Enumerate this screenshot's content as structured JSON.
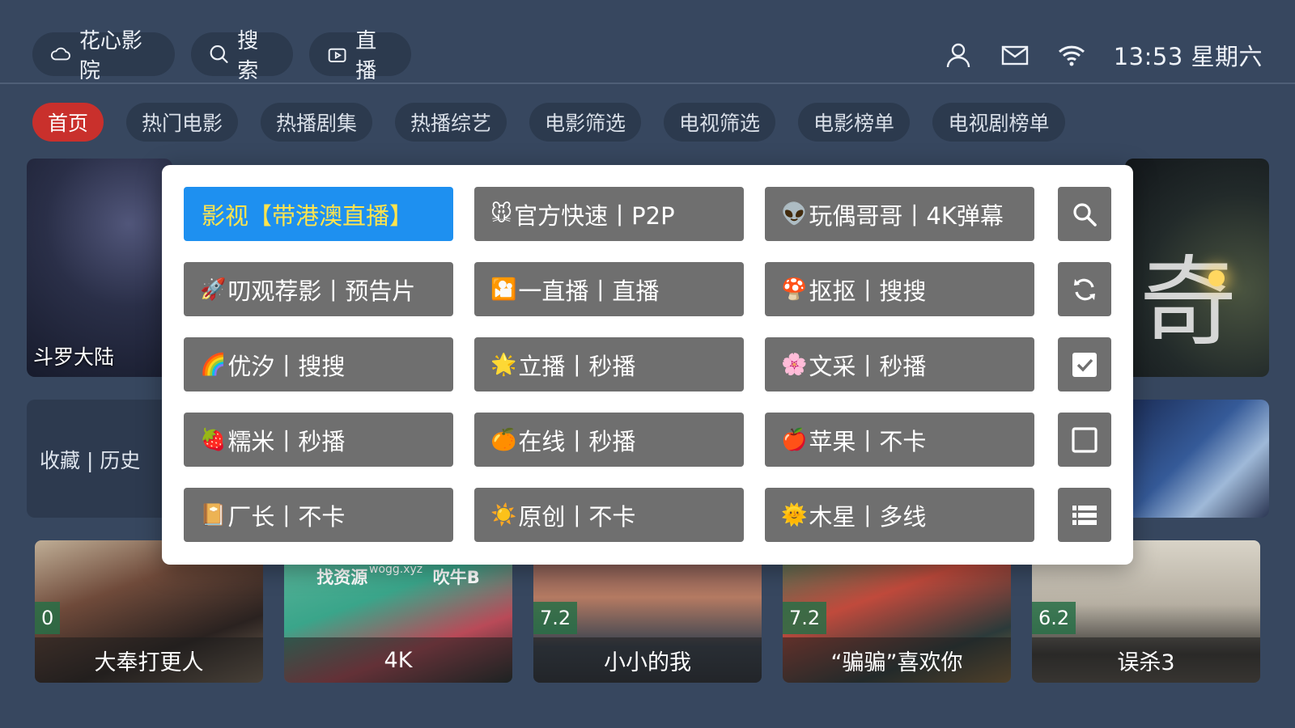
{
  "header": {
    "app_button": "花心影院",
    "search_button": "搜索",
    "live_button": "直播",
    "clock": "13:53 星期六",
    "icons": [
      "user-icon",
      "mail-icon",
      "wifi-icon"
    ]
  },
  "tabs": [
    "首页",
    "热门电影",
    "热播剧集",
    "热播综艺",
    "电影筛选",
    "电视筛选",
    "电影榜单",
    "电视剧榜单"
  ],
  "active_tab": "首页",
  "banner": {
    "left_title": "斗罗大陆",
    "right_glyph": "奇"
  },
  "favorites_label": "收藏 | 历史",
  "posters": [
    {
      "title": "大奉打更人",
      "score": "0"
    },
    {
      "title": "4K",
      "score": "",
      "top_left": "找资源",
      "top_right": "吹牛B",
      "sub": "wogg.xyz"
    },
    {
      "title": "小小的我",
      "score": "7.2"
    },
    {
      "title": "“骗骗”喜欢你",
      "score": "7.2"
    },
    {
      "title": "误杀3",
      "score": "6.2"
    }
  ],
  "source_dialog": {
    "sources": [
      [
        {
          "emoji": "",
          "label": "影视【带港澳直播】",
          "selected": true
        },
        {
          "emoji": "🐭",
          "label": "官方快速丨P2P"
        },
        {
          "emoji": "👽",
          "label": "玩偶哥哥丨4K弹幕"
        }
      ],
      [
        {
          "emoji": "🚀",
          "label": "叨观荐影丨预告片"
        },
        {
          "emoji": "🎦",
          "label": "一直播丨直播"
        },
        {
          "emoji": "🍄",
          "label": "抠抠丨搜搜"
        }
      ],
      [
        {
          "emoji": "🌈",
          "label": "优汐丨搜搜"
        },
        {
          "emoji": "🌟",
          "label": "立播丨秒播"
        },
        {
          "emoji": "🌸",
          "label": "文采丨秒播"
        }
      ],
      [
        {
          "emoji": "🍓",
          "label": "糯米丨秒播"
        },
        {
          "emoji": "🍊",
          "label": "在线丨秒播"
        },
        {
          "emoji": "🍎",
          "label": "苹果丨不卡"
        }
      ],
      [
        {
          "emoji": "📔",
          "label": "厂长丨不卡"
        },
        {
          "emoji": "☀️",
          "label": "原创丨不卡"
        },
        {
          "emoji": "🌞",
          "label": "木星丨多线"
        }
      ]
    ],
    "tools": [
      "search-icon",
      "refresh-icon",
      "checkbox-checked-icon",
      "checkbox-empty-icon",
      "list-icon"
    ]
  },
  "colors": {
    "background": "#37475f",
    "active_tab": "#c9302c",
    "selected_source": "#1e90f0",
    "selected_text": "#ffe44d",
    "source_button": "#6f6f6f"
  }
}
